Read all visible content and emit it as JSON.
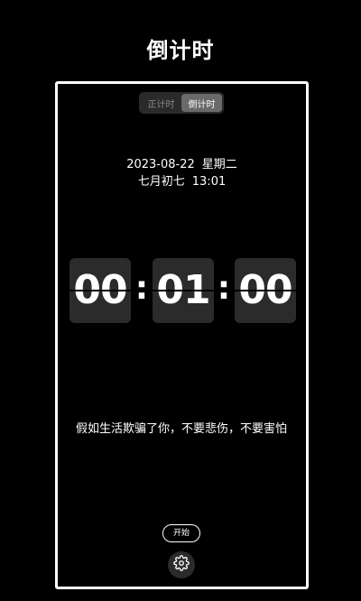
{
  "header": {
    "title": "倒计时"
  },
  "mode_toggle": {
    "tabs": [
      {
        "label": "正计时",
        "active": false
      },
      {
        "label": "倒计时",
        "active": true
      }
    ]
  },
  "datetime": {
    "date": "2023-08-22",
    "weekday": "星期二",
    "lunar": "七月初七",
    "time": "13:01"
  },
  "countdown": {
    "hours": "00",
    "minutes": "01",
    "seconds": "00",
    "separator": ":"
  },
  "quote": "假如生活欺骗了你，不要悲伤，不要害怕",
  "controls": {
    "start_label": "开始",
    "settings_icon": "gear-icon"
  },
  "colors": {
    "background": "#000000",
    "card": "#2b2b2b",
    "toggle_active": "#6a6a6a",
    "text": "#ffffff"
  }
}
